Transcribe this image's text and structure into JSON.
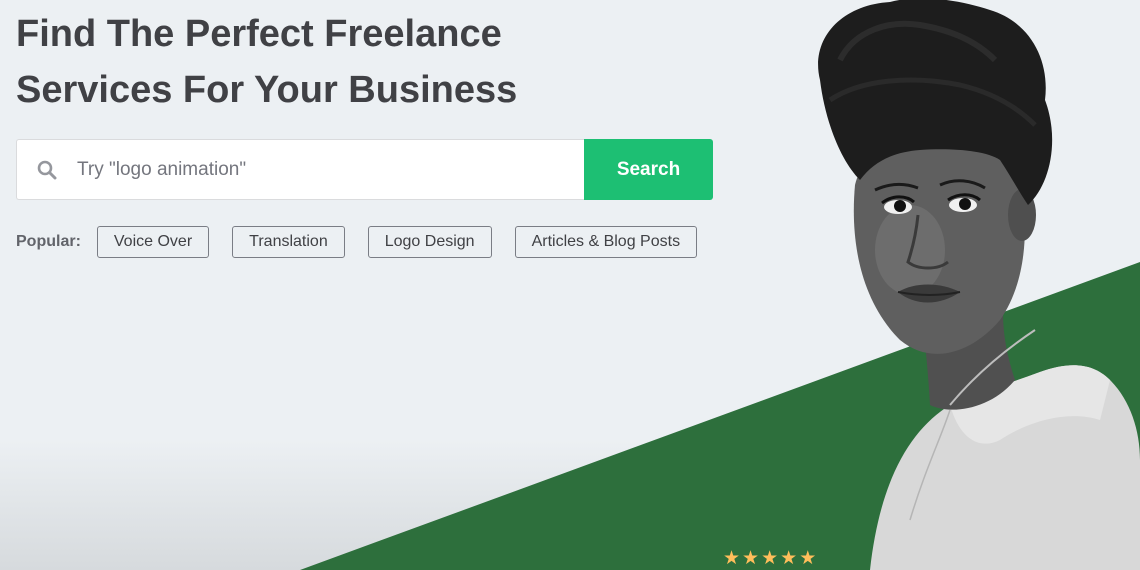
{
  "hero": {
    "title_line1": "Find The Perfect Freelance",
    "title_line2": "Services For Your Business"
  },
  "search": {
    "placeholder": "Try \"logo animation\"",
    "button_label": "Search",
    "icon": "search-icon"
  },
  "popular": {
    "label": "Popular:",
    "tags": [
      {
        "label": "Voice Over"
      },
      {
        "label": "Translation"
      },
      {
        "label": "Logo Design"
      },
      {
        "label": "Articles & Blog Posts"
      }
    ]
  },
  "rating": {
    "stars": 5,
    "star_color": "#ffbe5b"
  },
  "colors": {
    "brand_green": "#1dbf73",
    "wedge_green": "#2d6f3c",
    "background": "#ecf0f3",
    "heading": "#404145"
  }
}
